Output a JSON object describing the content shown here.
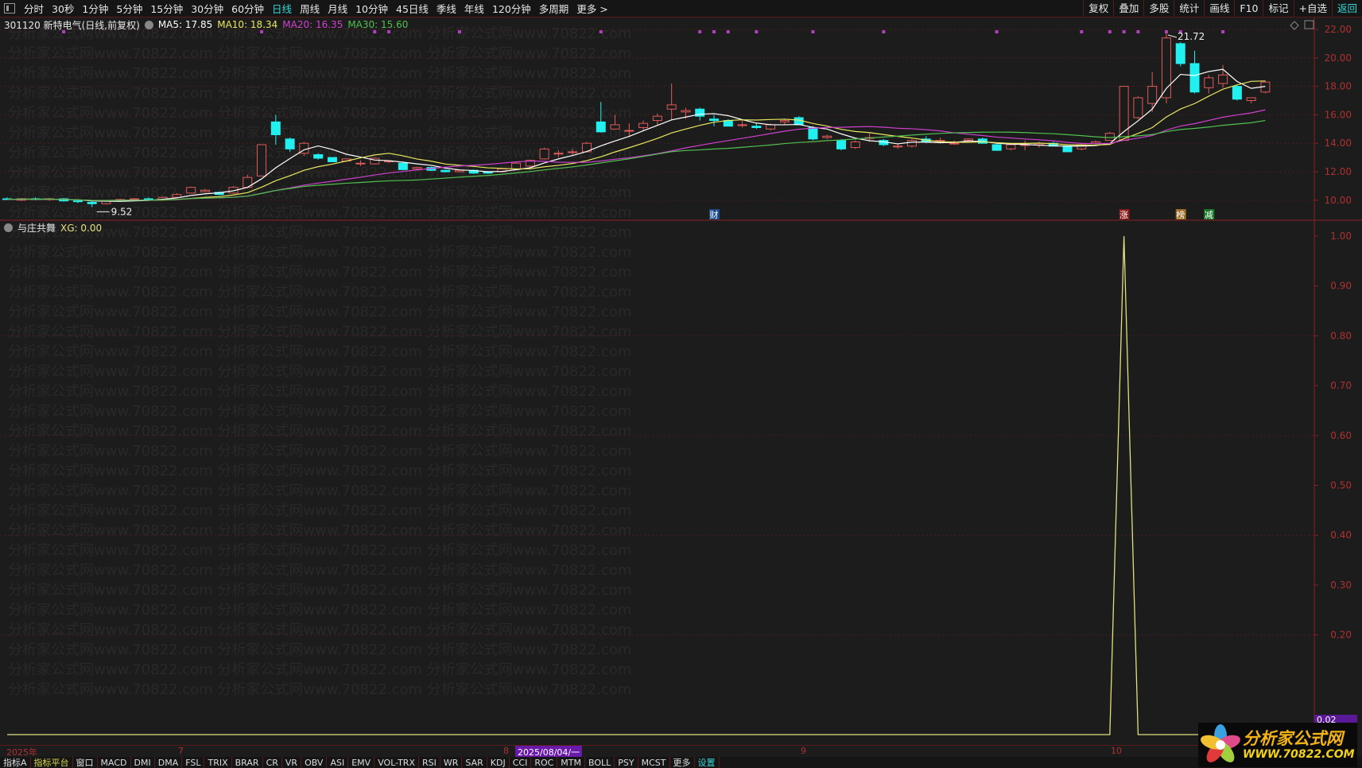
{
  "toolbar": {
    "periods": [
      "分时",
      "30秒",
      "1分钟",
      "5分钟",
      "15分钟",
      "30分钟",
      "60分钟",
      "日线",
      "周线",
      "月线",
      "10分钟",
      "45日线",
      "季线",
      "年线",
      "120分钟",
      "多周期",
      "更多 >"
    ],
    "active_period": "日线",
    "right_buttons": [
      "复权",
      "叠加",
      "多股",
      "统计",
      "画线",
      "F10",
      "标记",
      "+自选",
      "返回"
    ]
  },
  "stock": {
    "title": "301120 新特电气(日线,前复权)",
    "ma5": "MA5: 17.85",
    "ma10": "MA10: 18.34",
    "ma20": "MA20: 16.35",
    "ma30": "MA30: 15.60"
  },
  "indicator": {
    "name": "与庄共舞",
    "xg": "XG: 0.00",
    "last_value": "0.02"
  },
  "watermark": "分析家公式网www.70822.com",
  "logo": {
    "title": "分析家公式网",
    "url": "WWW.70822.COM"
  },
  "dates": {
    "year": "2025年",
    "m7": "7",
    "m8": "8",
    "m9": "9",
    "m10": "10",
    "cursor": "2025/08/04/一"
  },
  "indicator_tabs": [
    "指标A",
    "指标平台",
    "窗口",
    "MACD",
    "DMI",
    "DMA",
    "FSL",
    "TRIX",
    "BRAR",
    "CR",
    "VR",
    "OBV",
    "ASI",
    "EMV",
    "VOL-TRX",
    "RSI",
    "WR",
    "SAR",
    "KDJ",
    "CCI",
    "ROC",
    "MTM",
    "BOLL",
    "PSY",
    "MCST",
    "更多",
    "设置"
  ],
  "colors": {
    "up": "#e05a5a",
    "down": "#22f0f0",
    "ma5": "#ffffff",
    "ma10": "#e8e860",
    "ma20": "#d040d0",
    "ma30": "#50c050",
    "axis": "#b03030",
    "xg": "#e0e080",
    "signal": "#b040c0"
  },
  "chart_data": [
    {
      "type": "candlestick",
      "title": "301120 新特电气(日线,前复权)",
      "ylim": [
        9.5,
        22.5
      ],
      "yticks": [
        "22.00",
        "20.00",
        "18.00",
        "16.00",
        "14.00",
        "12.00",
        "10.00"
      ],
      "annotations": {
        "high": "21.72",
        "low": "9.52"
      },
      "markers": [
        {
          "index": 50,
          "label": "财",
          "color": "#1a4a8a"
        },
        {
          "index": 79,
          "label": "涨",
          "color": "#8a1a1a"
        },
        {
          "index": 83,
          "label": "榜",
          "color": "#9a6a20"
        },
        {
          "index": 85,
          "label": "减",
          "color": "#1a7a2a"
        }
      ],
      "signal_indices": [
        4,
        18,
        26,
        27,
        32,
        42,
        49,
        50,
        51,
        53,
        57,
        62,
        70,
        76,
        78,
        79,
        80,
        82,
        83,
        86
      ],
      "ohlc": [
        [
          10.1,
          10.2,
          10,
          10.05
        ],
        [
          10,
          10.15,
          9.95,
          10.1
        ],
        [
          10.1,
          10.2,
          10,
          10.05
        ],
        [
          10.05,
          10.15,
          9.95,
          10.1
        ],
        [
          10.1,
          10.15,
          9.9,
          9.95
        ],
        [
          9.95,
          10.05,
          9.8,
          9.9
        ],
        [
          9.85,
          9.95,
          9.52,
          9.75
        ],
        [
          9.75,
          10,
          9.7,
          9.95
        ],
        [
          9.95,
          10.1,
          9.9,
          10.05
        ],
        [
          10.05,
          10.15,
          10,
          10.1
        ],
        [
          10.1,
          10.2,
          10,
          10.05
        ],
        [
          10.05,
          10.25,
          10,
          10.2
        ],
        [
          10.2,
          10.5,
          10.15,
          10.4
        ],
        [
          10.5,
          10.95,
          10.5,
          10.9
        ],
        [
          10.6,
          10.8,
          10.55,
          10.7
        ],
        [
          10.55,
          10.6,
          10.35,
          10.4
        ],
        [
          10.5,
          11,
          10.45,
          10.9
        ],
        [
          10.9,
          11.8,
          10.85,
          11.6
        ],
        [
          11.7,
          13.9,
          11.7,
          13.9
        ],
        [
          15.5,
          16,
          13.9,
          14.6
        ],
        [
          14.3,
          14.4,
          13.4,
          13.6
        ],
        [
          13.3,
          14.1,
          13.1,
          14
        ],
        [
          13.2,
          13.3,
          12.85,
          12.95
        ],
        [
          13,
          13,
          12.7,
          12.7
        ],
        [
          12.75,
          12.95,
          12.7,
          12.9
        ],
        [
          12.6,
          12.8,
          12.4,
          12.6
        ],
        [
          12.55,
          13,
          12.5,
          12.95
        ],
        [
          12.7,
          12.8,
          12.6,
          12.75
        ],
        [
          12.6,
          12.65,
          12.1,
          12.15
        ],
        [
          12.2,
          12.35,
          12.1,
          12.3
        ],
        [
          12.3,
          12.35,
          12.05,
          12.1
        ],
        [
          12.1,
          12.15,
          11.95,
          12
        ],
        [
          12,
          12.15,
          11.95,
          12.1
        ],
        [
          12.1,
          12.15,
          11.85,
          11.9
        ],
        [
          12,
          12.05,
          11.85,
          11.9
        ],
        [
          12,
          12.25,
          11.95,
          12.2
        ],
        [
          12.2,
          12.7,
          12.15,
          12.6
        ],
        [
          12.4,
          12.85,
          12.3,
          12.8
        ],
        [
          12.9,
          13.7,
          12.85,
          13.6
        ],
        [
          13.3,
          13.5,
          13,
          13.3
        ],
        [
          13.4,
          13.6,
          13.2,
          13.4
        ],
        [
          13.4,
          14.1,
          13.35,
          14
        ],
        [
          15.5,
          16.9,
          14.75,
          14.8
        ],
        [
          15,
          16,
          15,
          15.3
        ],
        [
          14.9,
          15.4,
          14.5,
          14.9
        ],
        [
          15.1,
          15.6,
          14.9,
          15.4
        ],
        [
          15.6,
          16.1,
          15.3,
          15.9
        ],
        [
          16.4,
          18.2,
          15.6,
          16.7
        ],
        [
          16.2,
          16.5,
          15.7,
          16.3
        ],
        [
          16.4,
          16.5,
          15.6,
          15.9
        ],
        [
          15.7,
          16,
          15.2,
          15.6
        ],
        [
          15.6,
          15.7,
          15.2,
          15.2
        ],
        [
          15.3,
          15.6,
          15.1,
          15.3
        ],
        [
          15.2,
          15.4,
          15,
          15.1
        ],
        [
          15,
          15.4,
          14.9,
          15.3
        ],
        [
          15.5,
          15.7,
          15.3,
          15.6
        ],
        [
          15.8,
          15.9,
          15.3,
          15.3
        ],
        [
          15.1,
          15.2,
          14.2,
          14.3
        ],
        [
          14.4,
          14.6,
          14.3,
          14.5
        ],
        [
          14.2,
          14.3,
          13.5,
          13.6
        ],
        [
          13.7,
          14.2,
          13.6,
          14.1
        ],
        [
          14.4,
          14.7,
          14.1,
          14.4
        ],
        [
          14.2,
          14.3,
          13.8,
          13.9
        ],
        [
          13.8,
          14,
          13.6,
          13.8
        ],
        [
          13.8,
          14.3,
          13.7,
          14.2
        ],
        [
          14.3,
          14.5,
          14,
          14.1
        ],
        [
          14.2,
          14.4,
          14,
          14.2
        ],
        [
          14,
          14.2,
          13.9,
          14
        ],
        [
          14.2,
          14.35,
          14.1,
          14.3
        ],
        [
          14.3,
          14.4,
          14,
          14
        ],
        [
          13.9,
          13.95,
          13.5,
          13.5
        ],
        [
          13.6,
          14,
          13.5,
          13.9
        ],
        [
          13.9,
          14.2,
          13.5,
          13.9
        ],
        [
          13.9,
          14.1,
          13.7,
          14
        ],
        [
          14,
          14.1,
          13.8,
          13.8
        ],
        [
          13.8,
          13.85,
          13.4,
          13.4
        ],
        [
          13.6,
          14,
          13.5,
          13.9
        ],
        [
          14,
          14.2,
          13.9,
          14.1
        ],
        [
          14.2,
          14.8,
          14.2,
          14.7
        ],
        [
          14.2,
          18,
          14.2,
          18
        ],
        [
          15.8,
          17.3,
          15.7,
          17.2
        ],
        [
          16.8,
          19,
          16.2,
          18
        ],
        [
          17.2,
          21.72,
          16.8,
          21.4
        ],
        [
          21,
          21.1,
          19.4,
          19.6
        ],
        [
          19.6,
          20.5,
          17.5,
          17.6
        ],
        [
          17.9,
          18.8,
          17.5,
          18.6
        ],
        [
          18.2,
          19.5,
          17.9,
          18.8
        ],
        [
          18,
          18.1,
          17,
          17.1
        ],
        [
          17,
          17.2,
          16.8,
          17.2
        ],
        [
          17.6,
          18.4,
          17.5,
          18.3
        ]
      ],
      "ma_periods": [
        5,
        10,
        20,
        30
      ]
    },
    {
      "type": "line",
      "title": "与庄共舞",
      "series": [
        {
          "name": "XG",
          "spike_index": 79,
          "spike_value": 1.0,
          "baseline": 0
        }
      ],
      "count": 90,
      "yticks": [
        "1.00",
        "0.90",
        "0.80",
        "0.70",
        "0.60",
        "0.50",
        "0.40",
        "0.30",
        "0.20"
      ],
      "ylim": [
        0,
        1.0
      ]
    }
  ]
}
